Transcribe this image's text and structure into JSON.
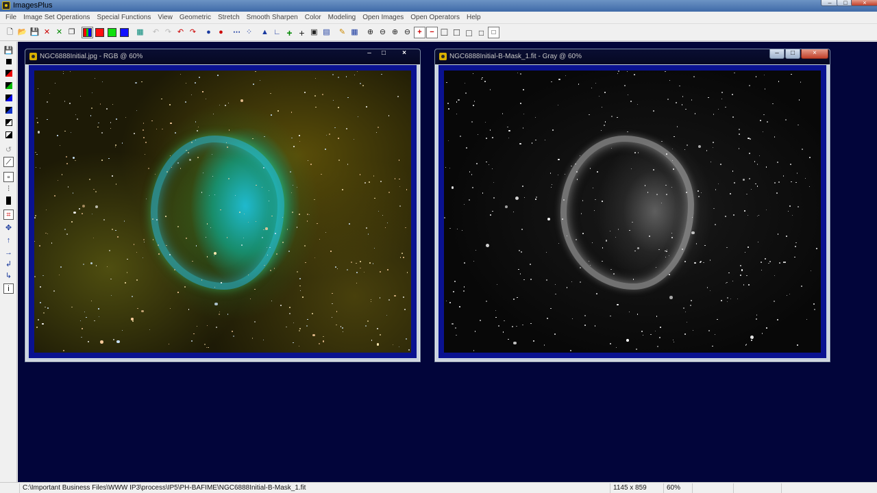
{
  "app": {
    "title": "ImagesPlus"
  },
  "window_controls": {
    "minimize": "–",
    "maximize": "□",
    "close": "×"
  },
  "menu": [
    "File",
    "Image Set Operations",
    "Special Functions",
    "View",
    "Geometric",
    "Stretch",
    "Smooth Sharpen",
    "Color",
    "Modeling",
    "Open Images",
    "Open Operators",
    "Help"
  ],
  "toolbar_icons": [
    {
      "name": "new-file-icon",
      "glyph": "🗋"
    },
    {
      "name": "open-folder-icon",
      "glyph": "📂"
    },
    {
      "name": "save-icon",
      "glyph": "💾"
    },
    {
      "name": "close-image-icon",
      "glyph": "✕"
    },
    {
      "name": "close-all-icon",
      "glyph": "✕"
    },
    {
      "name": "copy-window-icon",
      "glyph": "❐"
    },
    {
      "name": "rgb-channels-icon",
      "glyph": "▥"
    },
    {
      "name": "red-channel-icon",
      "glyph": ""
    },
    {
      "name": "green-channel-icon",
      "glyph": ""
    },
    {
      "name": "blue-channel-icon",
      "glyph": ""
    },
    {
      "name": "grid-icon",
      "glyph": "▦"
    },
    {
      "name": "undo-icon",
      "glyph": "↶"
    },
    {
      "name": "redo-icon",
      "glyph": "↷"
    },
    {
      "name": "undo-all-icon",
      "glyph": "↶"
    },
    {
      "name": "redo-all-icon",
      "glyph": "↷"
    },
    {
      "name": "mask-on-icon",
      "glyph": "●"
    },
    {
      "name": "mask-off-icon",
      "glyph": "●"
    },
    {
      "name": "dotted-line-icon",
      "glyph": "⋯"
    },
    {
      "name": "points-icon",
      "glyph": "⁘"
    },
    {
      "name": "histogram-icon",
      "glyph": "▲"
    },
    {
      "name": "axis-icon",
      "glyph": "∟"
    },
    {
      "name": "crosshair-plus-icon",
      "glyph": "+"
    },
    {
      "name": "crosshair-icon",
      "glyph": "+"
    },
    {
      "name": "select-grid-icon",
      "glyph": "▣"
    },
    {
      "name": "image-info-icon",
      "glyph": "▤"
    },
    {
      "name": "pencil-icon",
      "glyph": "✎"
    },
    {
      "name": "tile-icon",
      "glyph": "▦"
    },
    {
      "name": "zoom-in-icon",
      "glyph": "⊕"
    },
    {
      "name": "zoom-out-icon",
      "glyph": "⊖"
    },
    {
      "name": "zoom-fit-icon",
      "glyph": "⊕"
    },
    {
      "name": "zoom-actual-icon",
      "glyph": "⊖"
    },
    {
      "name": "add-window-icon",
      "glyph": "+"
    },
    {
      "name": "remove-window-icon",
      "glyph": "−"
    },
    {
      "name": "frame-large-icon",
      "glyph": "□"
    },
    {
      "name": "frame-medium-icon",
      "glyph": "□"
    },
    {
      "name": "frame-small-icon",
      "glyph": "□"
    },
    {
      "name": "frame-xsmall-icon",
      "glyph": "□"
    },
    {
      "name": "frame-tiny-icon",
      "glyph": "□"
    }
  ],
  "colors": {
    "workspace": "#02053a",
    "frame": "#0a1290",
    "red_swatch": "#ff1010",
    "green_swatch": "#10e010",
    "blue_swatch": "#1010ff"
  },
  "left_tools": [
    "save-icon",
    "black-square-icon",
    "red-black-icon",
    "green-black-icon",
    "blue-black-icon",
    "blue-black-icon",
    "black-white-icon",
    "black-white-icon",
    "clone-icon",
    "gradient-icon",
    "target-icon",
    "levels-icon",
    "black-bar-icon",
    "crop-icon",
    "move-icon",
    "arrow-up-icon",
    "arrow-right-icon",
    "rotate-left-icon",
    "rotate-right-icon",
    "info-icon"
  ],
  "windows": [
    {
      "title": "NGC6888Initial.jpg - RGB @ 60%",
      "kind": "rgb"
    },
    {
      "title": "NGC6888Initial-B-Mask_1.fit - Gray @ 60%",
      "kind": "gray"
    }
  ],
  "status": {
    "path": "C:\\Important Business Files\\WWW IP3\\process\\IP5\\PH-BAFIME\\NGC6888Initial-B-Mask_1.fit",
    "size": "1145 x 859",
    "zoom": "60%",
    "empty1": "",
    "empty2": "",
    "empty3": ""
  }
}
